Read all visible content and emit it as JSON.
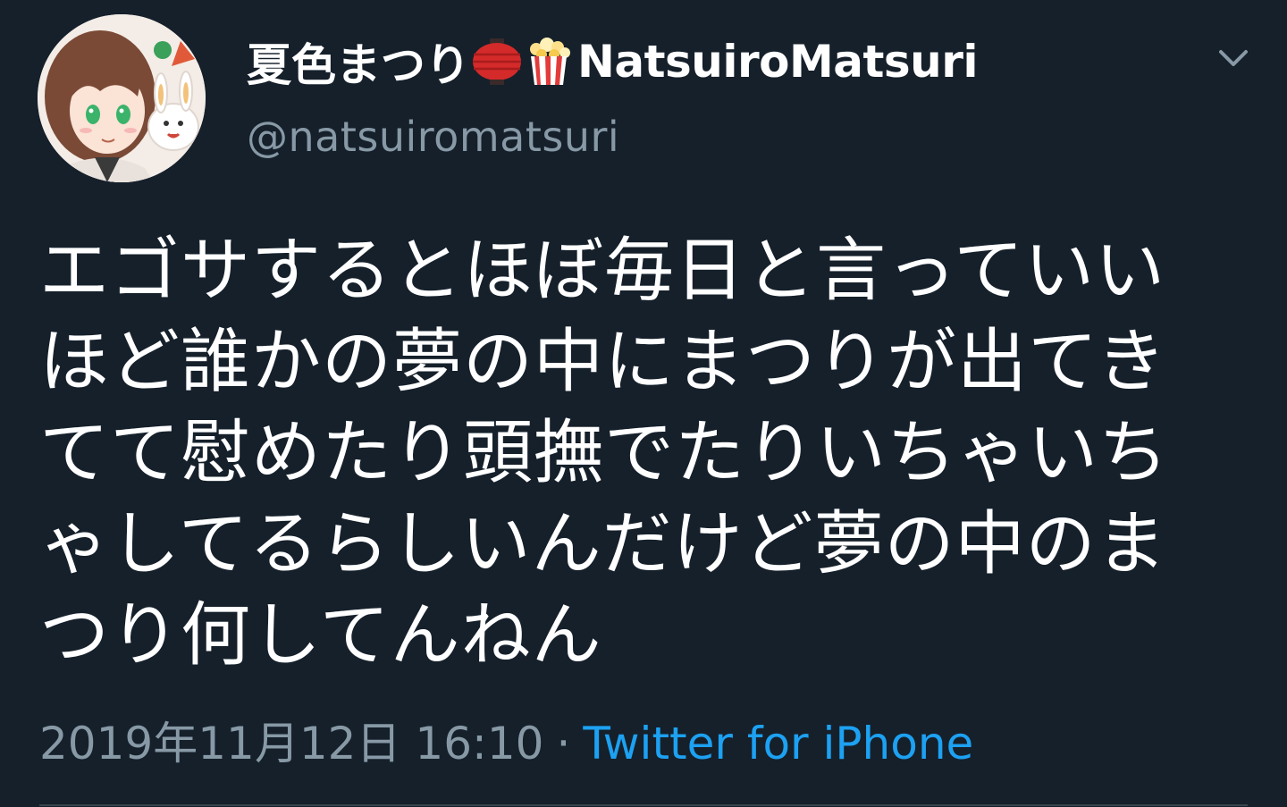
{
  "tweet": {
    "author": {
      "display_name_ja": "夏色まつり",
      "display_name_en": "NatsuiroMatsuri",
      "handle": "@natsuiromatsuri",
      "emojis": [
        "red-lantern-emoji",
        "popcorn-emoji"
      ],
      "avatar": "avatar-image"
    },
    "text": "エゴサするとほぼ毎日と言っていいほど誰かの夢の中にまつりが出てきてて慰めたり頭撫でたりいちゃいちゃしてるらしいんだけど夢の中のまつり何してんねん",
    "timestamp": "2019年11月12日 16:10",
    "separator": "·",
    "source": "Twitter for iPhone",
    "menu_icon": "chevron-down-icon"
  },
  "colors": {
    "background": "#15202b",
    "text_primary": "#ffffff",
    "text_secondary": "#8899a6",
    "link": "#1da1f2",
    "divider": "#38444d"
  }
}
